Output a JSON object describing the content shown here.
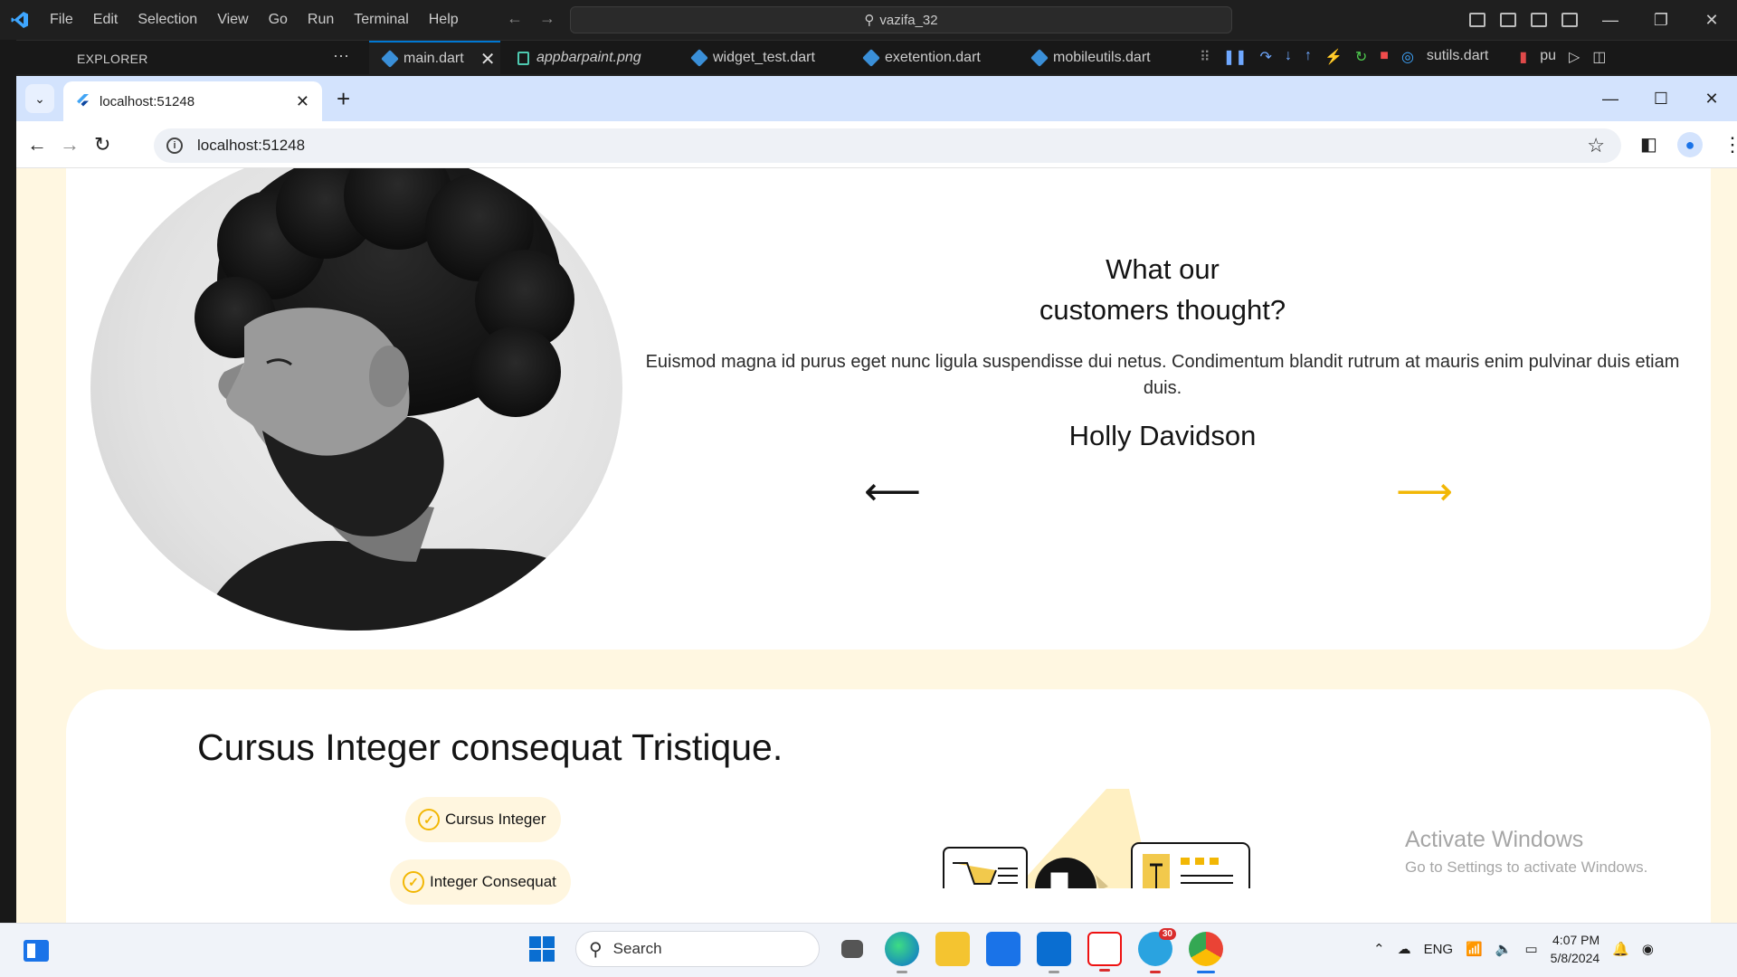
{
  "vscode": {
    "menu": [
      "File",
      "Edit",
      "Selection",
      "View",
      "Go",
      "Run",
      "Terminal",
      "Help"
    ],
    "search_text": "vazifa_32",
    "explorer_label": "EXPLORER",
    "tabs": [
      {
        "label": "main.dart"
      },
      {
        "label": "appbarpaint.png"
      },
      {
        "label": "widget_test.dart"
      },
      {
        "label": "exetention.dart"
      },
      {
        "label": "mobileutils.dart"
      },
      {
        "label": "sutils.dart"
      },
      {
        "label": "pu"
      }
    ]
  },
  "browser": {
    "tab_title": "localhost:51248",
    "url": "localhost:51248"
  },
  "page": {
    "testimonial": {
      "title_line1": "What our",
      "title_line2": "customers thought?",
      "body": "Euismod magna id purus eget nunc ligula suspendisse dui netus. Condimentum blandit rutrum at mauris enim pulvinar duis etiam duis.",
      "name": "Holly Davidson",
      "prev_arrow": "⟵",
      "next_arrow": "⟶"
    },
    "features": {
      "title": "Cursus Integer consequat Tristique.",
      "items": [
        "Cursus Integer",
        "Integer Consequat"
      ]
    }
  },
  "watermark": {
    "line1": "Activate Windows",
    "line2": "Go to Settings to activate Windows."
  },
  "taskbar": {
    "search_label": "Search",
    "telegram_badge": "30",
    "language": "ENG",
    "time": "4:07 PM",
    "date": "5/8/2024"
  },
  "colors": {
    "accent_yellow": "#f2b705",
    "page_bg": "#fff7e1",
    "vscode_blue": "#0078d4"
  }
}
